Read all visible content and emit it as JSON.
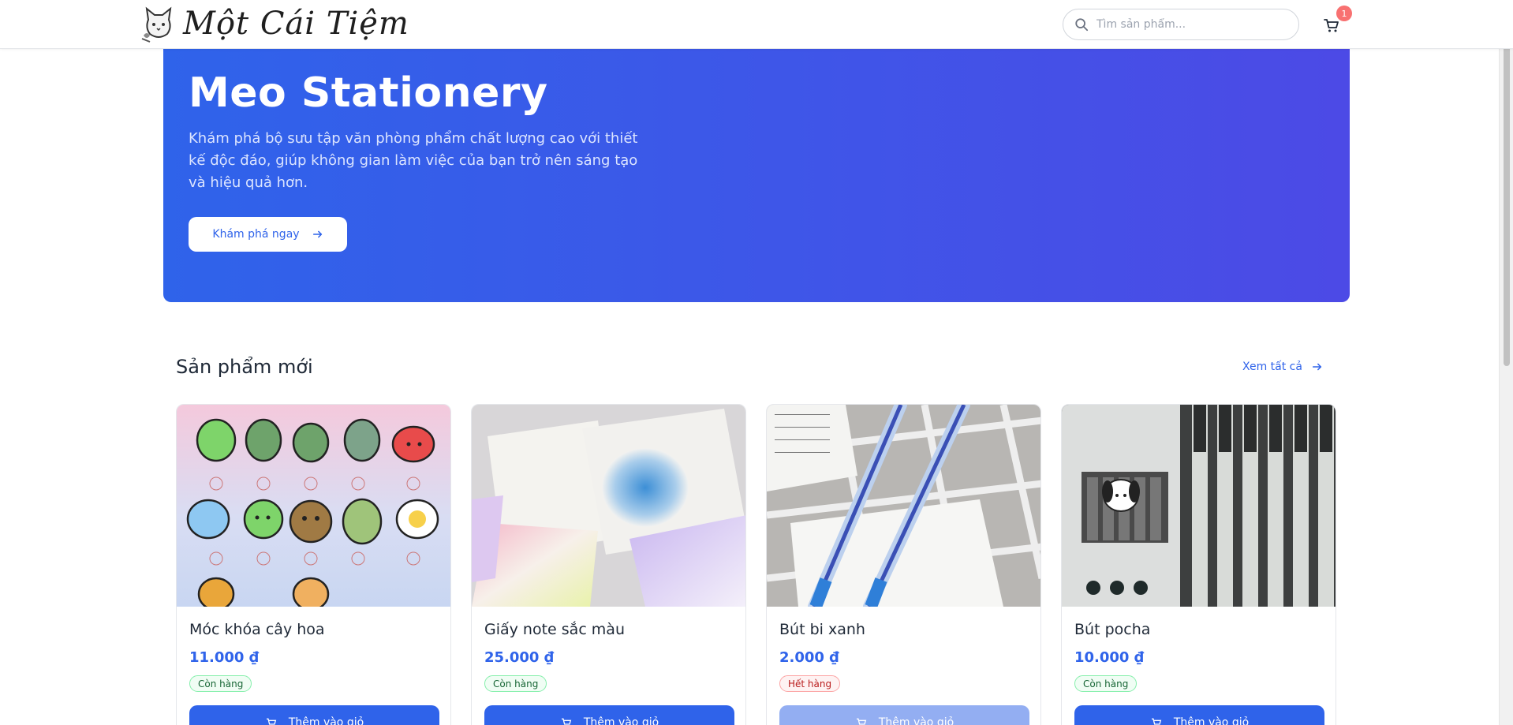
{
  "header": {
    "logo_text": "Một Cái Tiệm",
    "search_placeholder": "Tìm sản phẩm...",
    "cart_count": "1"
  },
  "hero": {
    "title": "Meo Stationery",
    "description": "Khám phá bộ sưu tập văn phòng phẩm chất lượng cao với thiết kế độc đáo, giúp không gian làm việc của bạn trở nên sáng tạo và hiệu quả hơn.",
    "cta_label": "Khám phá ngay"
  },
  "section": {
    "title": "Sản phẩm mới",
    "see_all_label": "Xem tất cả"
  },
  "products": [
    {
      "name": "Móc khóa cây hoa",
      "price": "11.000 ₫",
      "status": "Còn hàng",
      "button": "Thêm vào giỏ"
    },
    {
      "name": "Giấy note sắc màu",
      "price": "25.000 ₫",
      "status": "Còn hàng",
      "button": "Thêm vào giỏ"
    },
    {
      "name": "Bút bi xanh",
      "price": "2.000 ₫",
      "status": "Hết hàng",
      "button": "Thêm vào giỏ"
    },
    {
      "name": "Bút pocha",
      "price": "10.000 ₫",
      "status": "Còn hàng",
      "button": "Thêm vào giỏ"
    }
  ],
  "colors": {
    "primary": "#2f63ea",
    "hero_end": "#4c4ae6",
    "in_stock": "#166534",
    "out_of_stock": "#b91c1c"
  }
}
